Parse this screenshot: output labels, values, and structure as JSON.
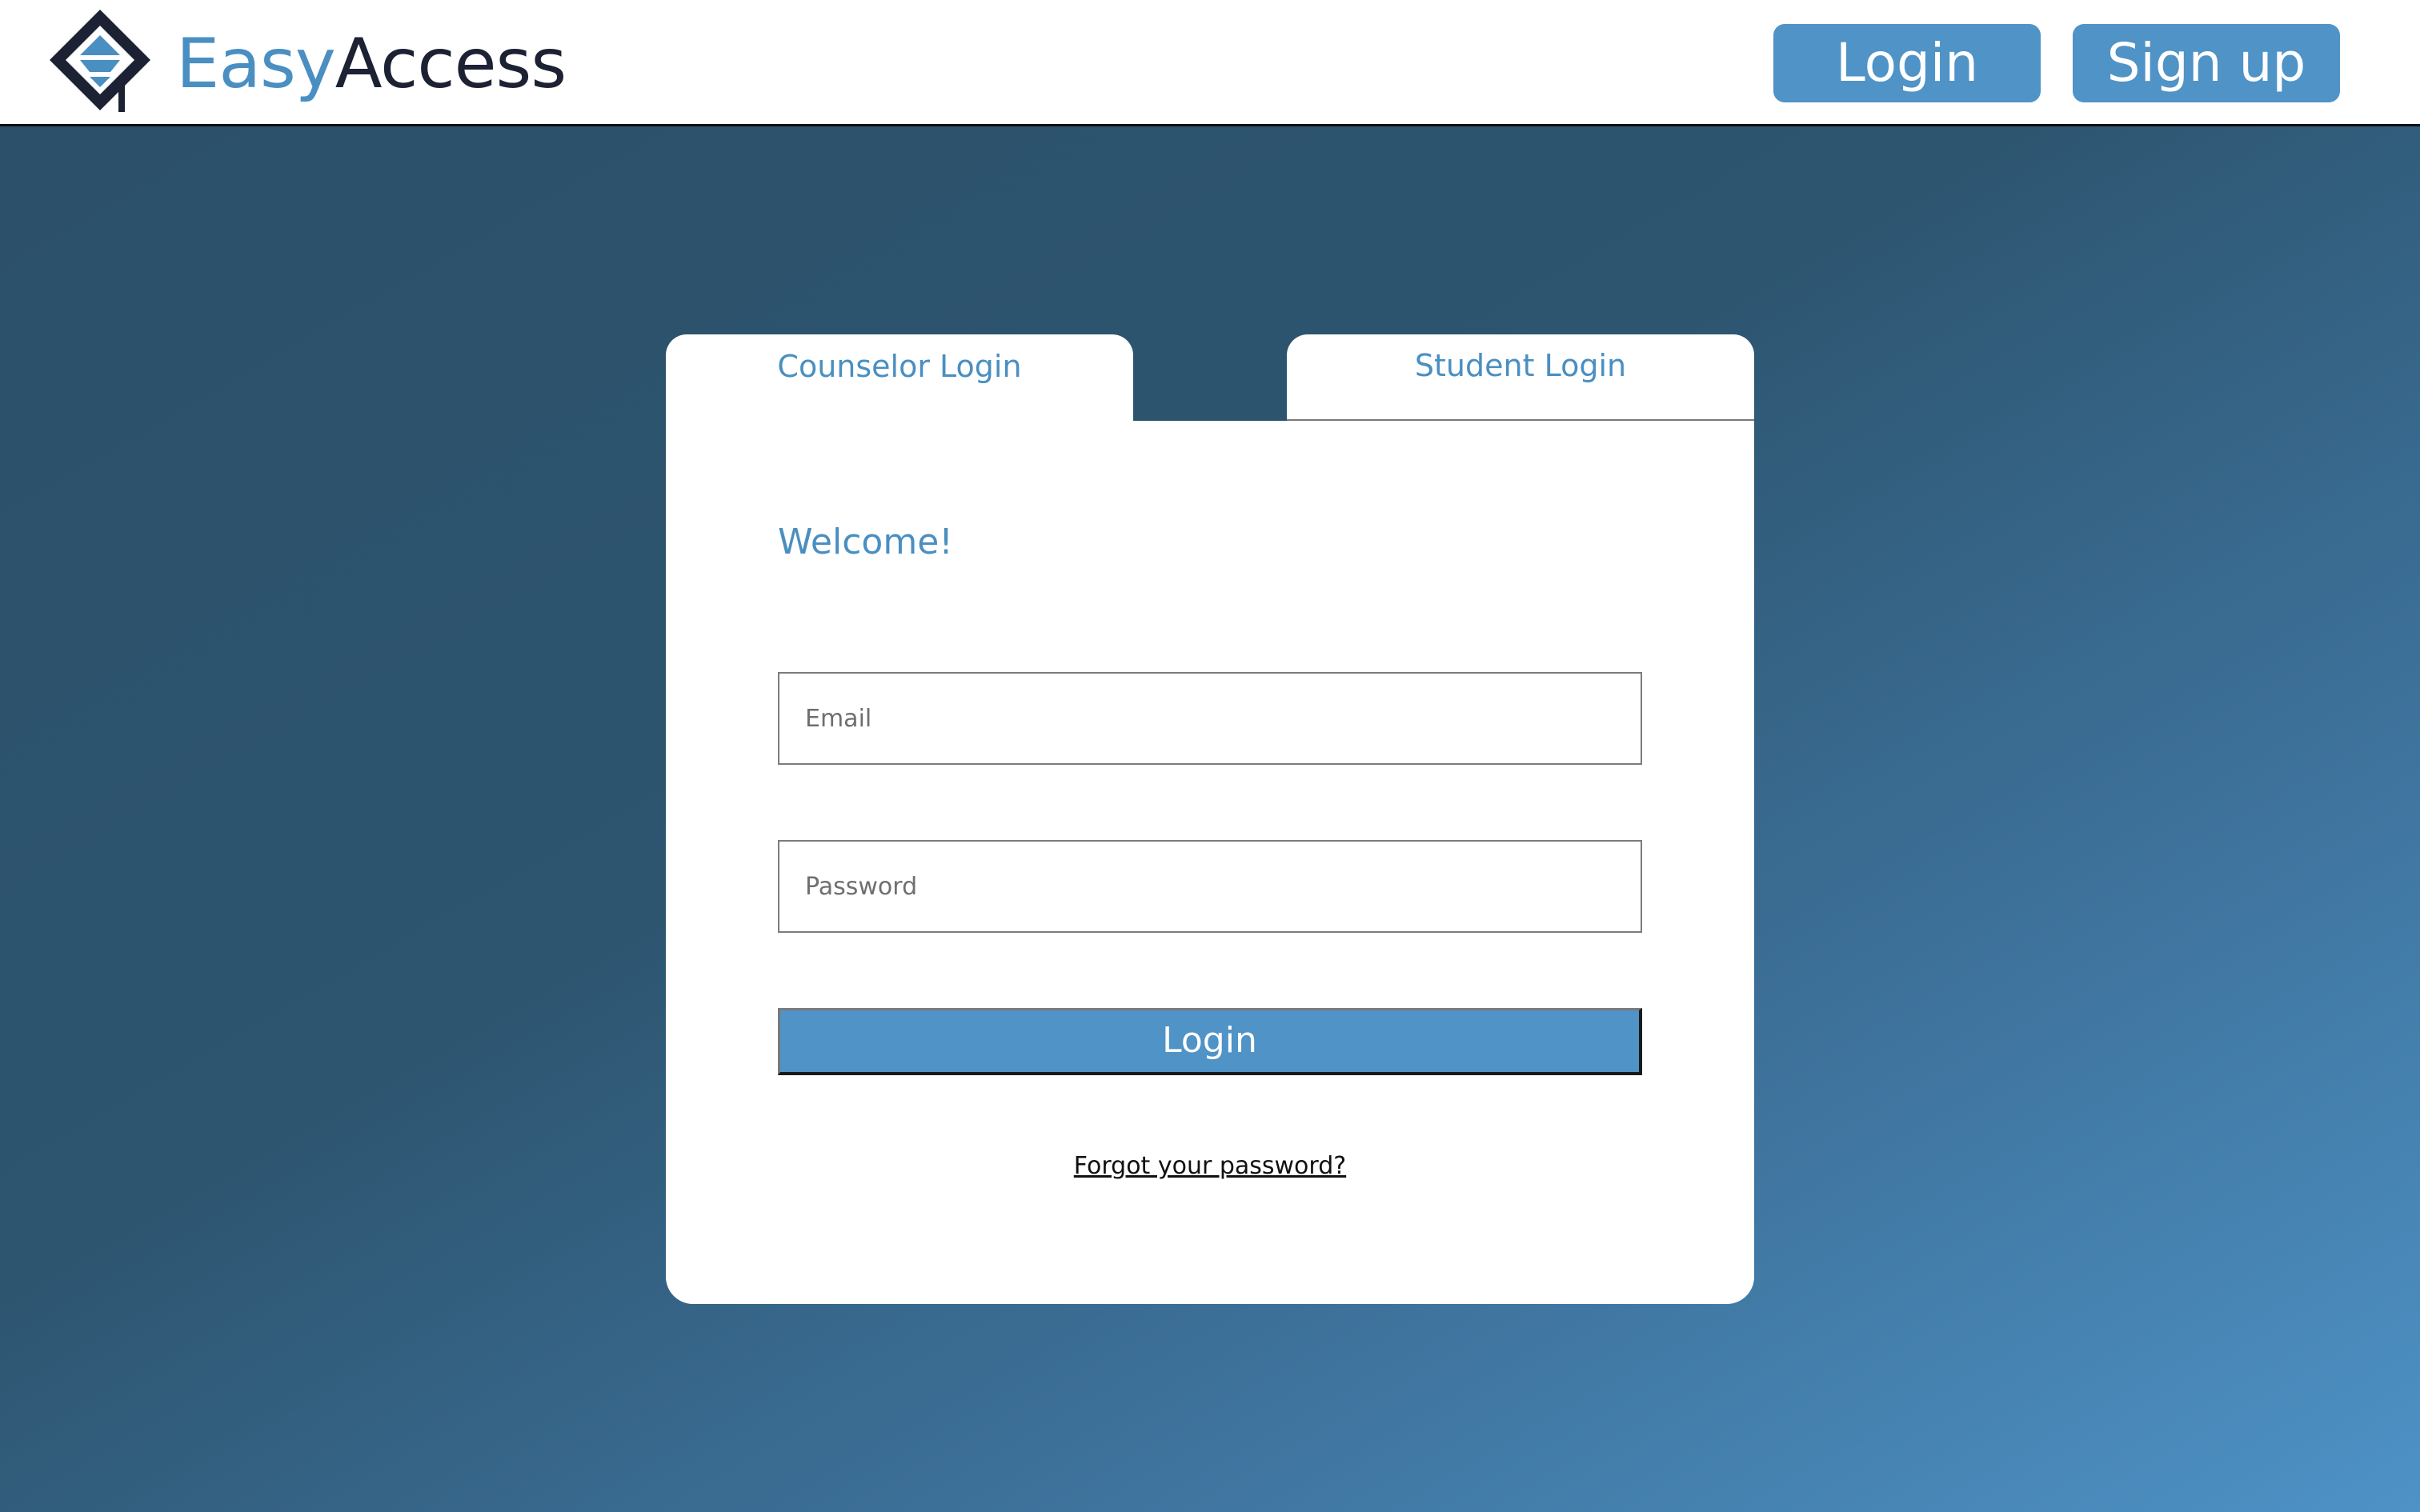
{
  "header": {
    "brand_part1": "Easy",
    "brand_part2": "Access",
    "login_label": "Login",
    "signup_label": "Sign up",
    "logo_icon": "graduation-cap-diamond-icon"
  },
  "tabs": {
    "counselor_label": "Counselor Login",
    "student_label": "Student Login",
    "active": "Counselor Login"
  },
  "form": {
    "welcome": "Welcome!",
    "email_placeholder": "Email",
    "email_value": "",
    "password_placeholder": "Password",
    "password_value": "",
    "submit_label": "Login",
    "forgot_label": "Forgot your password?"
  },
  "colors": {
    "accent": "#4f93c7",
    "dark": "#1c2233",
    "bg_dark": "#2c5069",
    "bg_light": "#4e92c6"
  }
}
